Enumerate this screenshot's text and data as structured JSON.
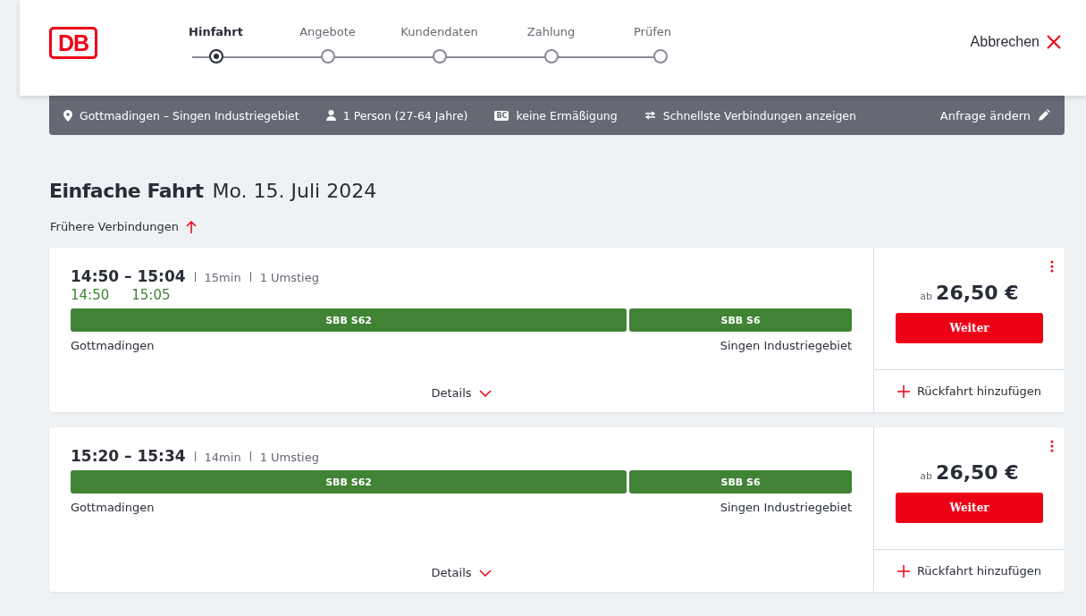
{
  "header": {
    "logo": "DB",
    "steps": [
      {
        "label": "Hinfahrt",
        "selected": true
      },
      {
        "label": "Angebote",
        "selected": false
      },
      {
        "label": "Kundendaten",
        "selected": false
      },
      {
        "label": "Zahlung",
        "selected": false
      },
      {
        "label": "Prüfen",
        "selected": false
      }
    ],
    "cancel": "Abbrechen"
  },
  "summary": {
    "items": [
      {
        "kind": "route",
        "text": "Gottmadingen – Singen Industriegebiet"
      },
      {
        "kind": "person",
        "text": "1 Person (27-64 Jahre)"
      },
      {
        "kind": "card",
        "badge": "BC",
        "text": "keine Ermäßigung"
      },
      {
        "kind": "filter",
        "text": "Schnellste Verbindungen anzeigen"
      }
    ],
    "edit": "Anfrage ändern"
  },
  "heading": {
    "title": "Einfache Fahrt",
    "date": "Mo. 15. Juli 2024"
  },
  "earlier": "Frühere Verbindungen",
  "connections": [
    {
      "times": "14:50 – 15:04",
      "duration": "15min",
      "transfers": "1 Umstieg",
      "realtime": [
        "14:50",
        "15:05"
      ],
      "segments": [
        "SBB S62",
        "SBB S6"
      ],
      "from": "Gottmadingen",
      "to": "Singen Industriegebiet",
      "details": "Details",
      "price_prefix": "ab",
      "price": "26,50 €",
      "button": "Weiter",
      "return": "Rückfahrt hinzufügen"
    },
    {
      "times": "15:20 – 15:34",
      "duration": "14min",
      "transfers": "1 Umstieg",
      "segments": [
        "SBB S62",
        "SBB S6"
      ],
      "from": "Gottmadingen",
      "to": "Singen Industriegebiet",
      "details": "Details",
      "price_prefix": "ab",
      "price": "26,50 €",
      "button": "Weiter",
      "return": "Rückfahrt hinzufügen"
    }
  ]
}
